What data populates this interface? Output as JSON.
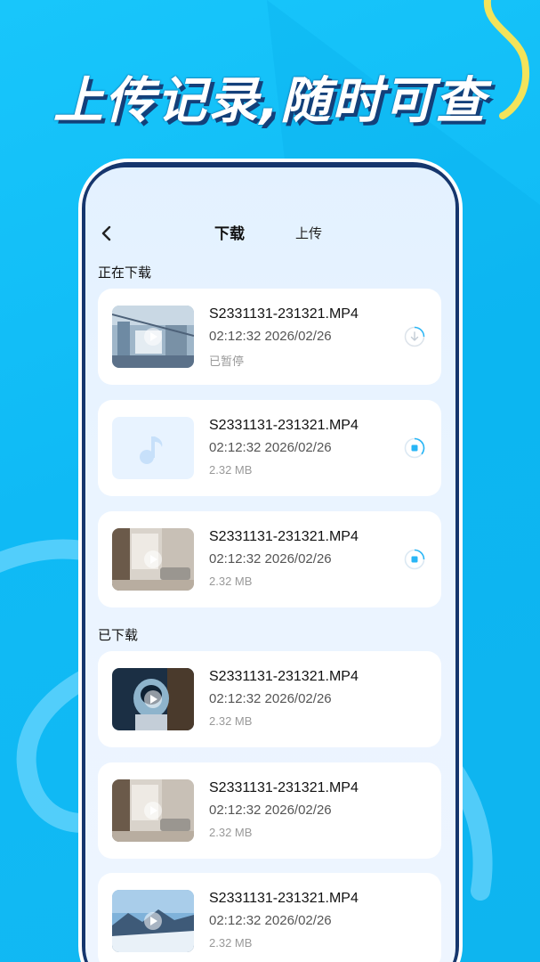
{
  "headline": "上传记录,随时可查",
  "header": {
    "tabs": [
      {
        "label": "下载",
        "active": true
      },
      {
        "label": "上传",
        "active": false
      }
    ]
  },
  "sections": {
    "downloading": {
      "title": "正在下载",
      "items": [
        {
          "name": "S2331131-231321.MP4",
          "time": "02:12:32 2026/02/26",
          "meta": "已暂停",
          "thumb": "factory-video-thumbnail",
          "status": "download-paused-icon"
        },
        {
          "name": "S2331131-231321.MP4",
          "time": "02:12:32 2026/02/26",
          "meta": "2.32 MB",
          "thumb": "music-note-placeholder",
          "status": "stop-progress-icon"
        },
        {
          "name": "S2331131-231321.MP4",
          "time": "02:12:32 2026/02/26",
          "meta": "2.32 MB",
          "thumb": "room-video-thumbnail",
          "status": "stop-progress-icon"
        }
      ]
    },
    "downloaded": {
      "title": "已下载",
      "items": [
        {
          "name": "S2331131-231321.MP4",
          "time": "02:12:32 2026/02/26",
          "meta": "2.32 MB",
          "thumb": "astronaut-video-thumbnail"
        },
        {
          "name": "S2331131-231321.MP4",
          "time": "02:12:32 2026/02/26",
          "meta": "2.32 MB",
          "thumb": "room-video-thumbnail"
        },
        {
          "name": "S2331131-231321.MP4",
          "time": "02:12:32 2026/02/26",
          "meta": "2.32 MB",
          "thumb": "snow-mountain-video-thumbnail"
        }
      ]
    }
  },
  "colors": {
    "background": "#12bdf6",
    "phone_frame": "#16366d",
    "accent": "#29b6f6",
    "accent_ring": "#aee4fb",
    "headline_shadow": "#13407a",
    "decor_yellow": "#f3e35a"
  }
}
